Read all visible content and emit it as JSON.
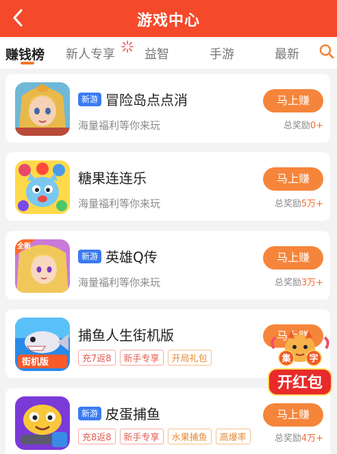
{
  "header": {
    "title": "游戏中心",
    "back_icon": "chevron-left-icon",
    "bg_color": "#f5492b"
  },
  "tabs": [
    {
      "label": "赚钱榜",
      "active": true
    },
    {
      "label": "新人专享",
      "active": false
    },
    {
      "label": "益智",
      "active": false
    },
    {
      "label": "手游",
      "active": false
    },
    {
      "label": "最新",
      "active": false
    }
  ],
  "games": [
    {
      "badge": "新游",
      "name": "冒险岛点点消",
      "subtitle": "海量福利等你来玩",
      "button": "马上赚",
      "reward_label": "总奖励",
      "reward_amount": "0+"
    },
    {
      "badge": "",
      "name": "糖果连连乐",
      "subtitle": "海量福利等你来玩",
      "button": "马上赚",
      "reward_label": "总奖励",
      "reward_amount": "5万+"
    },
    {
      "badge": "新游",
      "name": "英雄Q传",
      "subtitle": "海量福利等你来玩",
      "button": "马上赚",
      "reward_label": "总奖励",
      "reward_amount": "3万+"
    },
    {
      "badge": "",
      "name": "捕鱼人生街机版",
      "tags": [
        "充7返8",
        "新手专享",
        "开局礼包"
      ],
      "button": "马上赚"
    },
    {
      "badge": "新游",
      "name": "皮蛋捕鱼",
      "tags": [
        "充8返8",
        "新手专享",
        "水果捕鱼",
        "高爆率"
      ],
      "button": "马上赚",
      "reward_label": "总奖励",
      "reward_amount": "4万+"
    }
  ],
  "redpacket": {
    "small_chars": [
      "集",
      "字"
    ],
    "label": "开红包"
  },
  "icon_text": {
    "game3_corner": "全新",
    "game4_banner": "街机版"
  }
}
